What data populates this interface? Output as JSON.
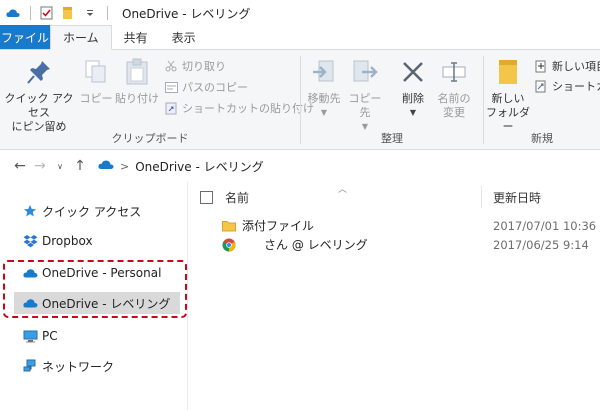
{
  "window": {
    "title": "OneDrive - レベリング"
  },
  "tabs": [
    {
      "label": "ファイル"
    },
    {
      "label": "ホーム"
    },
    {
      "label": "共有"
    },
    {
      "label": "表示"
    }
  ],
  "ribbon": {
    "clipboard": {
      "label": "クリップボード",
      "pin_line1": "クイック アクセス",
      "pin_line2": "にピン留め",
      "copy": "コピー",
      "paste": "貼り付け",
      "cut": "切り取り",
      "copy_path": "パスのコピー",
      "paste_shortcut": "ショートカットの貼り付け"
    },
    "organize": {
      "label": "整理",
      "move_to": "移動先",
      "copy_to": "コピー先",
      "delete": "削除",
      "rename_line1": "名前の",
      "rename_line2": "変更"
    },
    "new": {
      "label": "新規",
      "new_folder_line1": "新しい",
      "new_folder_line2": "フォルダー",
      "new_item": "新しい項目",
      "shortcut": "ショートカ"
    }
  },
  "address": {
    "crumb": "OneDrive - レベリング"
  },
  "nav": {
    "quick_access": "クイック アクセス",
    "dropbox": "Dropbox",
    "onedrive_personal": "OneDrive - Personal",
    "onedrive_leveling": "OneDrive - レベリング",
    "pc": "PC",
    "network": "ネットワーク"
  },
  "columns": {
    "name": "名前",
    "modified": "更新日時"
  },
  "files": [
    {
      "name": "添付ファイル",
      "date": "2017/07/01 10:36",
      "icon": "folder-icon"
    },
    {
      "name": "さん @ レベリング",
      "date": "2017/06/25 9:14",
      "icon": "chrome-icon"
    }
  ],
  "colors": {
    "accent": "#1979ca",
    "highlight": "#d0021b",
    "folder": "#f3c54a"
  }
}
